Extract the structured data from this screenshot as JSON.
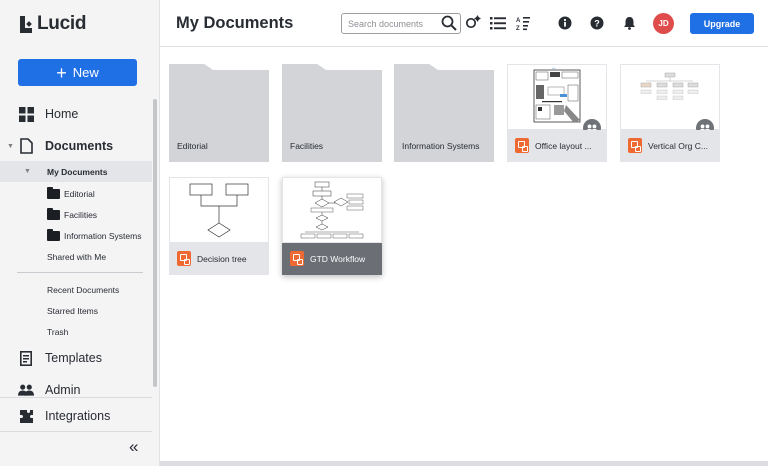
{
  "app": {
    "brand": "Lucid",
    "brand_color": "#1f6fe5"
  },
  "header": {
    "title": "My Documents",
    "search_placeholder": "Search documents",
    "avatar_initials": "JD",
    "upgrade_label": "Upgrade",
    "icons": [
      "search-icon",
      "shared-settings-icon",
      "list-view-icon",
      "sort-icon",
      "info-icon",
      "help-icon",
      "bell-icon"
    ]
  },
  "sidebar": {
    "new_label": "New",
    "home": "Home",
    "documents": "Documents",
    "my_documents": "My Documents",
    "folders": [
      "Editorial",
      "Facilities",
      "Information Systems"
    ],
    "shared_with_me": "Shared with Me",
    "recent": "Recent Documents",
    "starred": "Starred Items",
    "trash": "Trash",
    "templates": "Templates",
    "admin": "Admin",
    "integrations": "Integrations",
    "collapse": "«"
  },
  "grid": {
    "folders": [
      {
        "name": "Editorial"
      },
      {
        "name": "Facilities"
      },
      {
        "name": "Information Systems"
      }
    ],
    "documents": [
      {
        "name": "Office layout ...",
        "shared": true
      },
      {
        "name": "Vertical Org C...",
        "shared": true
      },
      {
        "name": "Decision tree",
        "shared": false
      },
      {
        "name": "GTD Workflow",
        "shared": false,
        "selected": true
      }
    ]
  }
}
